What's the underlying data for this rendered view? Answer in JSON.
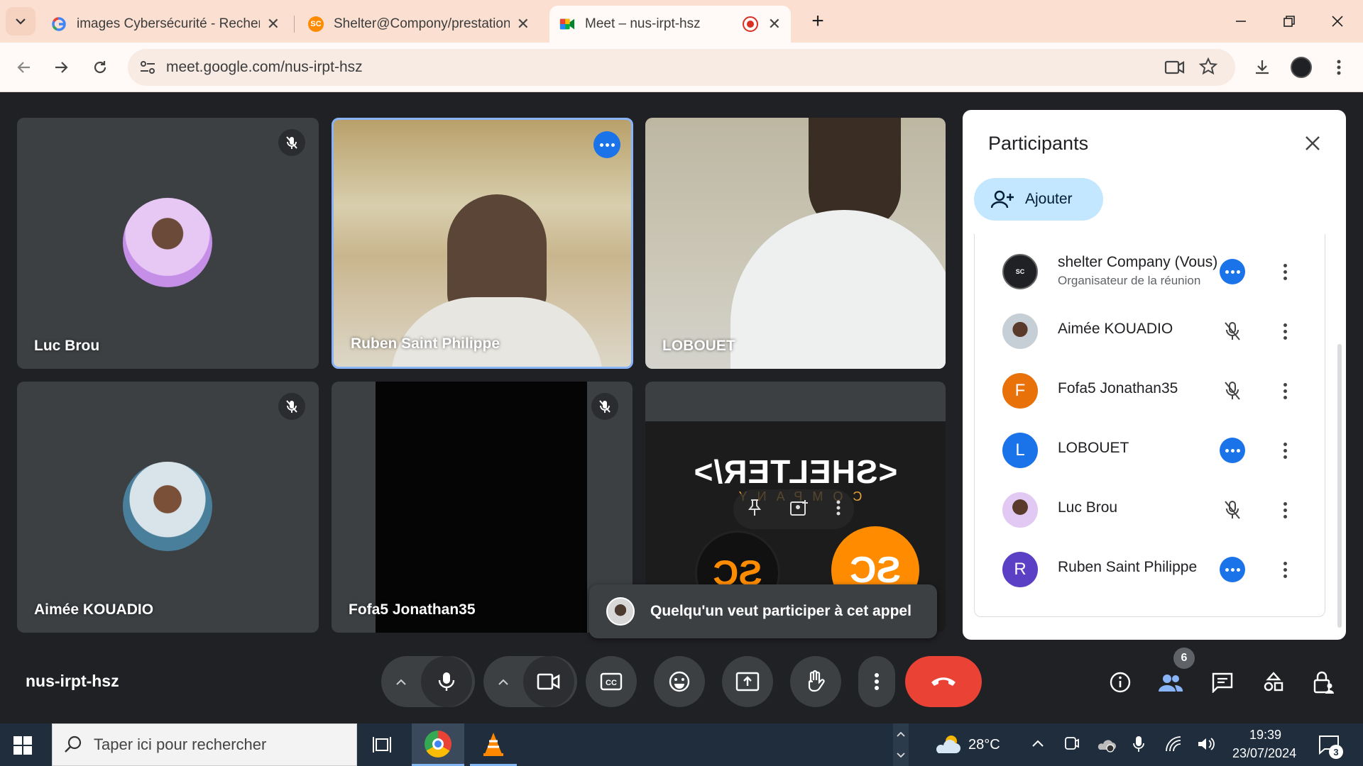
{
  "browser": {
    "tabs": [
      {
        "title": "images Cybersécurité - Recherche",
        "active": false,
        "icon": "google-icon"
      },
      {
        "title": "Shelter@Compony/prestation_d",
        "active": false,
        "icon": "sc-favicon"
      },
      {
        "title": "Meet – nus-irpt-hsz",
        "active": true,
        "icon": "meet-icon",
        "recording": true
      }
    ],
    "new_tab": "+",
    "url": "meet.google.com/nus-irpt-hsz"
  },
  "meet": {
    "tiles": [
      {
        "name": "Luc Brou",
        "muted": true,
        "type": "avatar"
      },
      {
        "name": "Ruben Saint Philippe",
        "muted": false,
        "type": "video",
        "active_speaker": true
      },
      {
        "name": "LOBOUET",
        "muted": false,
        "type": "video"
      },
      {
        "name": "Aimée KOUADIO",
        "muted": true,
        "type": "avatar"
      },
      {
        "name": "Fofa5 Jonathan35",
        "muted": true,
        "type": "video-dark"
      },
      {
        "name": "",
        "muted": false,
        "type": "screen-share",
        "logo_text": "<SHELTER/>",
        "logo_sub": "COMPANY",
        "badge_text": "SC"
      }
    ],
    "meeting_code": "nus-irpt-hsz",
    "notification": "Quelqu'un veut participer à cet appel",
    "participants_count": "6",
    "panel": {
      "title": "Participants",
      "add_label": "Ajouter",
      "participants": [
        {
          "name": "shelter Company (Vous)",
          "subtitle": "Organisateur de la réunion",
          "status": "speaking",
          "avatar_color": "#202124",
          "initial": ""
        },
        {
          "name": "Aimée KOUADIO",
          "subtitle": "",
          "status": "muted",
          "avatar_color": "#8d9aa6",
          "initial": ""
        },
        {
          "name": "Fofa5 Jonathan35",
          "subtitle": "",
          "status": "muted",
          "avatar_color": "#e8710a",
          "initial": "F"
        },
        {
          "name": "LOBOUET",
          "subtitle": "",
          "status": "speaking",
          "avatar_color": "#1a73e8",
          "initial": "L"
        },
        {
          "name": "Luc Brou",
          "subtitle": "",
          "status": "muted",
          "avatar_color": "#c9a7e8",
          "initial": ""
        },
        {
          "name": "Ruben Saint Philippe",
          "subtitle": "",
          "status": "speaking",
          "avatar_color": "#5b3fc4",
          "initial": "R"
        }
      ]
    }
  },
  "taskbar": {
    "search_placeholder": "Taper ici pour rechercher",
    "weather": "28°C",
    "time": "19:39",
    "date": "23/07/2024",
    "notifications": "3"
  },
  "colors": {
    "accent": "#1a73e8",
    "end_call": "#ea4335",
    "tab_strip": "#fbe0d2"
  }
}
